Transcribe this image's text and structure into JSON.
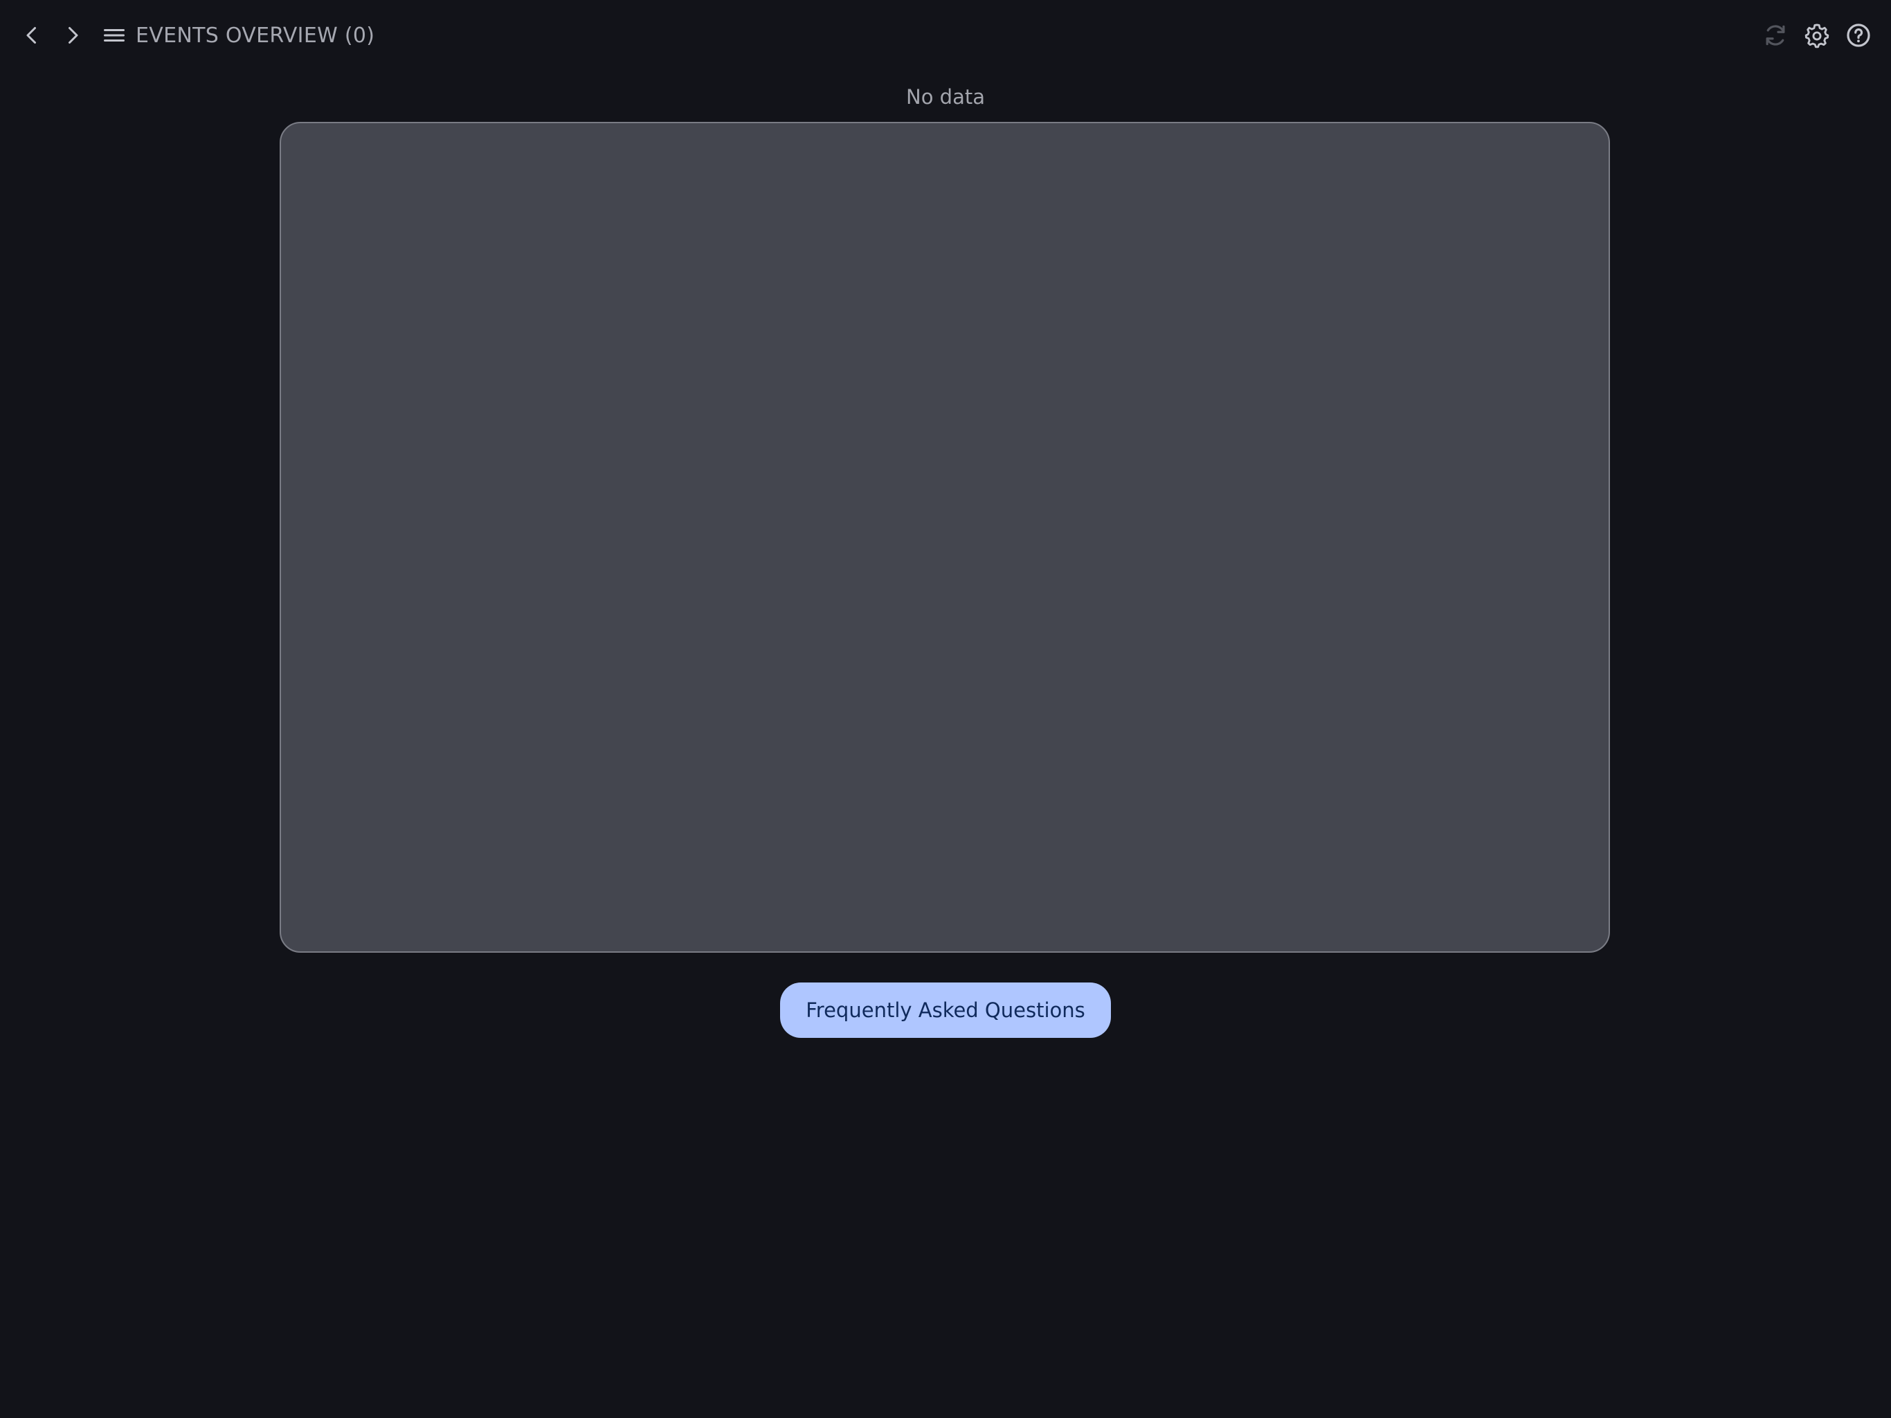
{
  "header": {
    "title": "EVENTS OVERVIEW (0)",
    "icons": {
      "back": "chevron-left-icon",
      "forward": "chevron-right-icon",
      "menu": "menu-icon",
      "refresh": "refresh-icon",
      "settings": "gear-icon",
      "help": "help-circle-icon"
    }
  },
  "main": {
    "status_text": "No data"
  },
  "footer": {
    "faq_label": "Frequently Asked Questions"
  },
  "colors": {
    "background": "#121319",
    "panel": "#44464f",
    "accent_button": "#afc6ff",
    "accent_button_text": "#102a5c",
    "muted_text": "#a6a8b1"
  }
}
